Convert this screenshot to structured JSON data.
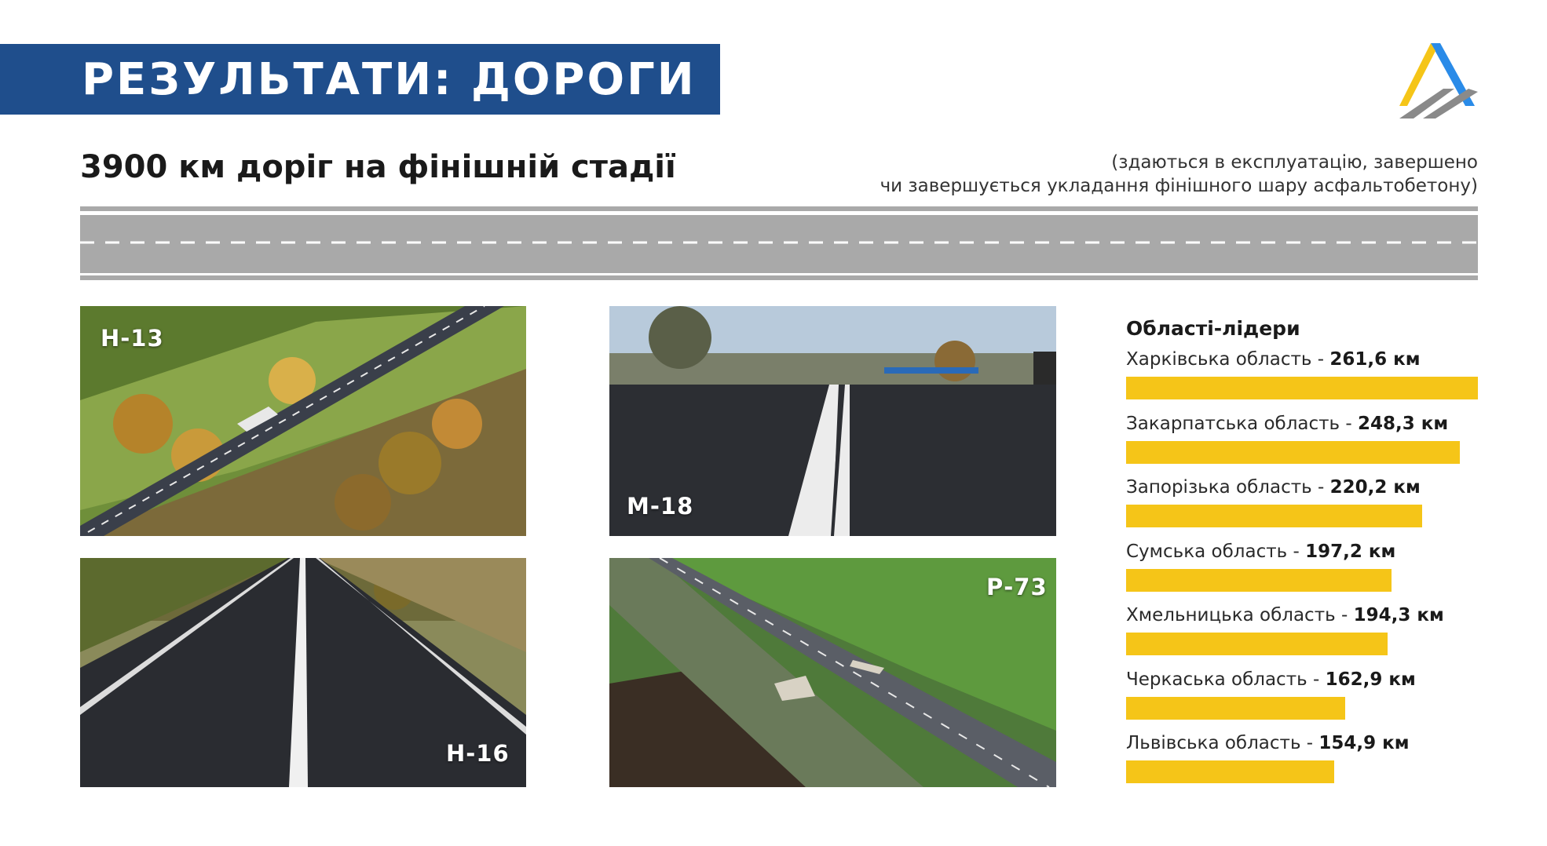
{
  "header": {
    "title": "РЕЗУЛЬТАТИ: ДОРОГИ",
    "subtitle": "3900 км доріг на фінішній стадії",
    "note_line1": "(здаються в експлуатацію, завершено",
    "note_line2": "чи завершується укладання фінішного шару асфальтобетону)"
  },
  "logo": {
    "icon": "road-agency-logo",
    "colors": [
      "#f5c518",
      "#2a8be8",
      "#8a8a8a"
    ]
  },
  "photos": [
    {
      "label": "Н-13"
    },
    {
      "label": "М-18"
    },
    {
      "label": "Н-16"
    },
    {
      "label": "Р-73"
    }
  ],
  "colors": {
    "title_band": "#1f4e8c",
    "bar": "#f5c518",
    "road": "#a9a9a9"
  },
  "chart_data": {
    "type": "bar",
    "orientation": "horizontal",
    "title": "Області-лідери",
    "unit": "км",
    "categories": [
      "Харківська область",
      "Закарпатська область",
      "Запорізька область",
      "Сумська область",
      "Хмельницька область",
      "Черкаська область",
      "Львівська область"
    ],
    "value_labels": [
      "261,6 км",
      "248,3 км",
      "220,2 км",
      "197,2 км",
      "194,3 км",
      "162,9 км",
      "154,9 км"
    ],
    "values": [
      261.6,
      248.3,
      220.2,
      197.2,
      194.3,
      162.9,
      154.9
    ],
    "separator": " - ",
    "xlim": [
      0,
      261.6
    ],
    "grid": false,
    "legend": "none"
  }
}
